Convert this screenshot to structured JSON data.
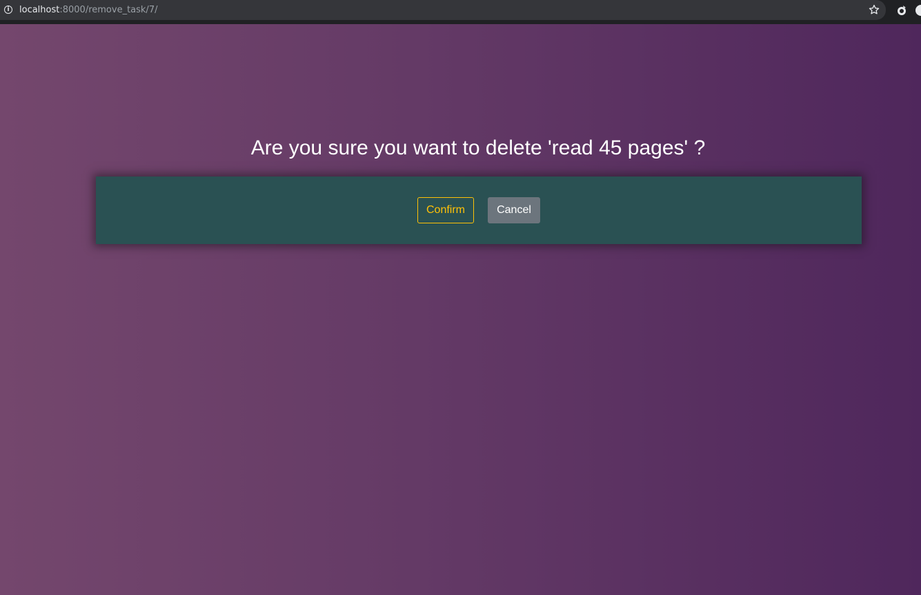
{
  "browser": {
    "url_host": "localhost",
    "url_rest": ":8000/remove_task/7/"
  },
  "dialog": {
    "message": "Are you sure you want to delete 'read 45 pages' ?",
    "confirm_label": "Confirm",
    "cancel_label": "Cancel"
  },
  "colors": {
    "background_gradient_start": "#74476d",
    "background_gradient_end": "#4f275c",
    "panel": "#2a5153",
    "confirm_outline": "#ffc107",
    "cancel_fill": "#6c757d"
  },
  "icons": {
    "address_bar": "info-icon",
    "bookmark": "star-icon",
    "extension_1": "extension-icon",
    "extension_2": "extension-icon"
  }
}
